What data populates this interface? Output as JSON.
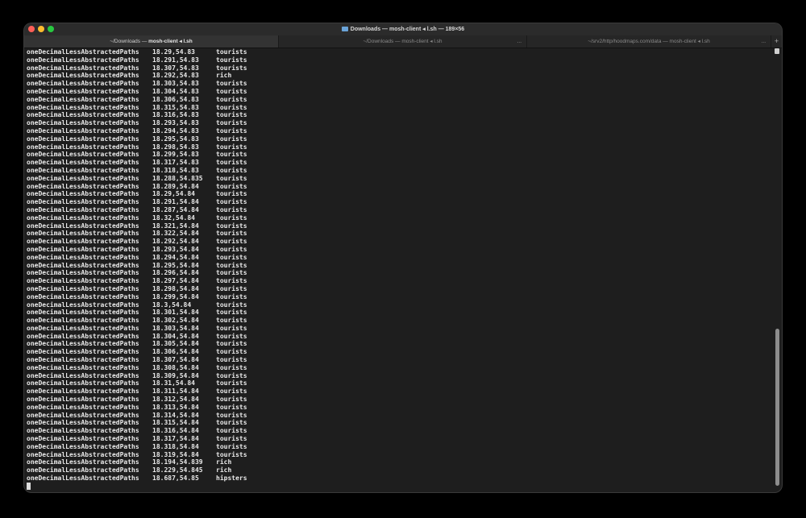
{
  "window": {
    "title": "Downloads — mosh-client ◂ l.sh — 189×56"
  },
  "tabs": [
    {
      "prefix": "~/Downloads — ",
      "bold": "mosh-client ◂ l.sh",
      "more": ""
    },
    {
      "prefix": "~/Downloads — mosh-client ◂ l.sh",
      "bold": "",
      "more": "..."
    },
    {
      "prefix": "~/srv2/http/hoodmaps.com/data — mosh-client ◂ l.sh",
      "bold": "",
      "more": "..."
    }
  ],
  "tab_add": "+",
  "terminal": {
    "rows": [
      [
        "oneDecimalLessAbstractedPaths",
        "18.29,54.83",
        "tourists"
      ],
      [
        "oneDecimalLessAbstractedPaths",
        "18.291,54.83",
        "tourists"
      ],
      [
        "oneDecimalLessAbstractedPaths",
        "18.307,54.83",
        "tourists"
      ],
      [
        "oneDecimalLessAbstractedPaths",
        "18.292,54.83",
        "rich"
      ],
      [
        "oneDecimalLessAbstractedPaths",
        "18.303,54.83",
        "tourists"
      ],
      [
        "oneDecimalLessAbstractedPaths",
        "18.304,54.83",
        "tourists"
      ],
      [
        "oneDecimalLessAbstractedPaths",
        "18.306,54.83",
        "tourists"
      ],
      [
        "oneDecimalLessAbstractedPaths",
        "18.315,54.83",
        "tourists"
      ],
      [
        "oneDecimalLessAbstractedPaths",
        "18.316,54.83",
        "tourists"
      ],
      [
        "oneDecimalLessAbstractedPaths",
        "18.293,54.83",
        "tourists"
      ],
      [
        "oneDecimalLessAbstractedPaths",
        "18.294,54.83",
        "tourists"
      ],
      [
        "oneDecimalLessAbstractedPaths",
        "18.295,54.83",
        "tourists"
      ],
      [
        "oneDecimalLessAbstractedPaths",
        "18.298,54.83",
        "tourists"
      ],
      [
        "oneDecimalLessAbstractedPaths",
        "18.299,54.83",
        "tourists"
      ],
      [
        "oneDecimalLessAbstractedPaths",
        "18.317,54.83",
        "tourists"
      ],
      [
        "oneDecimalLessAbstractedPaths",
        "18.318,54.83",
        "tourists"
      ],
      [
        "oneDecimalLessAbstractedPaths",
        "18.288,54.835",
        "tourists"
      ],
      [
        "oneDecimalLessAbstractedPaths",
        "18.289,54.84",
        "tourists"
      ],
      [
        "oneDecimalLessAbstractedPaths",
        "18.29,54.84",
        "tourists"
      ],
      [
        "oneDecimalLessAbstractedPaths",
        "18.291,54.84",
        "tourists"
      ],
      [
        "oneDecimalLessAbstractedPaths",
        "18.287,54.84",
        "tourists"
      ],
      [
        "oneDecimalLessAbstractedPaths",
        "18.32,54.84",
        "tourists"
      ],
      [
        "oneDecimalLessAbstractedPaths",
        "18.321,54.84",
        "tourists"
      ],
      [
        "oneDecimalLessAbstractedPaths",
        "18.322,54.84",
        "tourists"
      ],
      [
        "oneDecimalLessAbstractedPaths",
        "18.292,54.84",
        "tourists"
      ],
      [
        "oneDecimalLessAbstractedPaths",
        "18.293,54.84",
        "tourists"
      ],
      [
        "oneDecimalLessAbstractedPaths",
        "18.294,54.84",
        "tourists"
      ],
      [
        "oneDecimalLessAbstractedPaths",
        "18.295,54.84",
        "tourists"
      ],
      [
        "oneDecimalLessAbstractedPaths",
        "18.296,54.84",
        "tourists"
      ],
      [
        "oneDecimalLessAbstractedPaths",
        "18.297,54.84",
        "tourists"
      ],
      [
        "oneDecimalLessAbstractedPaths",
        "18.298,54.84",
        "tourists"
      ],
      [
        "oneDecimalLessAbstractedPaths",
        "18.299,54.84",
        "tourists"
      ],
      [
        "oneDecimalLessAbstractedPaths",
        "18.3,54.84",
        "tourists"
      ],
      [
        "oneDecimalLessAbstractedPaths",
        "18.301,54.84",
        "tourists"
      ],
      [
        "oneDecimalLessAbstractedPaths",
        "18.302,54.84",
        "tourists"
      ],
      [
        "oneDecimalLessAbstractedPaths",
        "18.303,54.84",
        "tourists"
      ],
      [
        "oneDecimalLessAbstractedPaths",
        "18.304,54.84",
        "tourists"
      ],
      [
        "oneDecimalLessAbstractedPaths",
        "18.305,54.84",
        "tourists"
      ],
      [
        "oneDecimalLessAbstractedPaths",
        "18.306,54.84",
        "tourists"
      ],
      [
        "oneDecimalLessAbstractedPaths",
        "18.307,54.84",
        "tourists"
      ],
      [
        "oneDecimalLessAbstractedPaths",
        "18.308,54.84",
        "tourists"
      ],
      [
        "oneDecimalLessAbstractedPaths",
        "18.309,54.84",
        "tourists"
      ],
      [
        "oneDecimalLessAbstractedPaths",
        "18.31,54.84",
        "tourists"
      ],
      [
        "oneDecimalLessAbstractedPaths",
        "18.311,54.84",
        "tourists"
      ],
      [
        "oneDecimalLessAbstractedPaths",
        "18.312,54.84",
        "tourists"
      ],
      [
        "oneDecimalLessAbstractedPaths",
        "18.313,54.84",
        "tourists"
      ],
      [
        "oneDecimalLessAbstractedPaths",
        "18.314,54.84",
        "tourists"
      ],
      [
        "oneDecimalLessAbstractedPaths",
        "18.315,54.84",
        "tourists"
      ],
      [
        "oneDecimalLessAbstractedPaths",
        "18.316,54.84",
        "tourists"
      ],
      [
        "oneDecimalLessAbstractedPaths",
        "18.317,54.84",
        "tourists"
      ],
      [
        "oneDecimalLessAbstractedPaths",
        "18.318,54.84",
        "tourists"
      ],
      [
        "oneDecimalLessAbstractedPaths",
        "18.319,54.84",
        "tourists"
      ],
      [
        "oneDecimalLessAbstractedPaths",
        "18.194,54.839",
        "rich"
      ],
      [
        "oneDecimalLessAbstractedPaths",
        "18.229,54.845",
        "rich"
      ],
      [
        "oneDecimalLessAbstractedPaths",
        "18.687,54.85",
        "hipsters"
      ]
    ]
  }
}
